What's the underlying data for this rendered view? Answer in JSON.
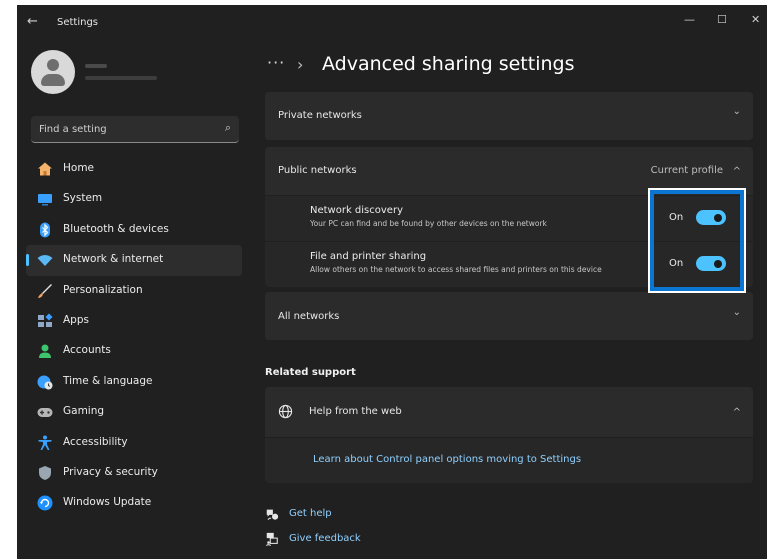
{
  "window": {
    "title": "Settings",
    "back_glyph": "←",
    "minimize_glyph": "—",
    "maximize_glyph": "☐",
    "close_glyph": "✕"
  },
  "search": {
    "placeholder": "Find a setting",
    "icon": "⌕"
  },
  "sidebar": {
    "items": [
      {
        "label": "Home",
        "icon": "home-icon",
        "color": "#f5b26b",
        "active": false
      },
      {
        "label": "System",
        "icon": "system-icon",
        "color": "#3aa0ff",
        "active": false
      },
      {
        "label": "Bluetooth & devices",
        "icon": "bluetooth-icon",
        "color": "#3aa0ff",
        "active": false
      },
      {
        "label": "Network & internet",
        "icon": "wifi-icon",
        "color": "#5ab8f5",
        "active": true
      },
      {
        "label": "Personalization",
        "icon": "brush-icon",
        "color": "#f4a261",
        "active": false
      },
      {
        "label": "Apps",
        "icon": "apps-icon",
        "color": "#8fa8c8",
        "active": false
      },
      {
        "label": "Accounts",
        "icon": "accounts-icon",
        "color": "#3ec46d",
        "active": false
      },
      {
        "label": "Time & language",
        "icon": "globe-clock-icon",
        "color": "#3aa0ff",
        "active": false
      },
      {
        "label": "Gaming",
        "icon": "gamepad-icon",
        "color": "#b5b5b5",
        "active": false
      },
      {
        "label": "Accessibility",
        "icon": "accessibility-icon",
        "color": "#3aa0ff",
        "active": false
      },
      {
        "label": "Privacy & security",
        "icon": "shield-icon",
        "color": "#9aa6b2",
        "active": false
      },
      {
        "label": "Windows Update",
        "icon": "windows-update-icon",
        "color": "#1e90ff",
        "active": false
      }
    ]
  },
  "header": {
    "dots": "···",
    "separator": "›",
    "title": "Advanced sharing settings"
  },
  "sections": {
    "private": {
      "label": "Private networks",
      "chevron": "⌄"
    },
    "public": {
      "label": "Public networks",
      "status": "Current profile",
      "chevron": "^",
      "settings": [
        {
          "title": "Network discovery",
          "description": "Your PC can find and be found by other devices on the network",
          "state": "On",
          "enabled": true
        },
        {
          "title": "File and printer sharing",
          "description": "Allow others on the network to access shared files and printers on this device",
          "state": "On",
          "enabled": true
        }
      ]
    },
    "all": {
      "label": "All networks",
      "chevron": "⌄"
    }
  },
  "related": {
    "heading": "Related support",
    "help_web": {
      "label": "Help from the web",
      "chevron": "^"
    },
    "link": "Learn about Control panel options moving to Settings"
  },
  "footer": {
    "get_help": "Get help",
    "give_feedback": "Give feedback"
  },
  "colors": {
    "accent": "#4cc2ff",
    "highlight_border": "#0b76d1",
    "background": "#202020",
    "card": "#2b2b2b"
  }
}
